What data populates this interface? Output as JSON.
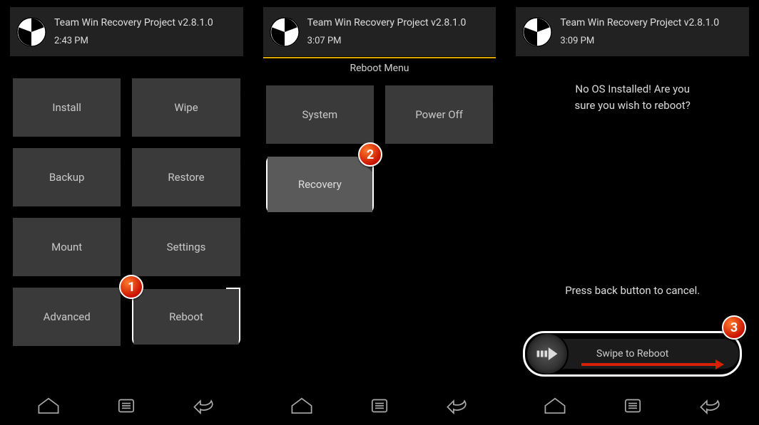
{
  "app_title": "Team Win Recovery Project  v2.8.1.0",
  "panel1": {
    "time": "2:43 PM",
    "buttons": [
      "Install",
      "Wipe",
      "Backup",
      "Restore",
      "Mount",
      "Settings",
      "Advanced",
      "Reboot"
    ]
  },
  "panel2": {
    "time": "3:07 PM",
    "menu_title": "Reboot Menu",
    "buttons": [
      "System",
      "Power Off",
      "Recovery"
    ]
  },
  "panel3": {
    "time": "3:09 PM",
    "warning_line1": "No OS Installed! Are you",
    "warning_line2": "sure you wish to reboot?",
    "hint": "Press back button to cancel.",
    "slider_label": "Swipe to Reboot"
  },
  "annotations": {
    "b1": "1",
    "b2": "2",
    "b3": "3"
  }
}
